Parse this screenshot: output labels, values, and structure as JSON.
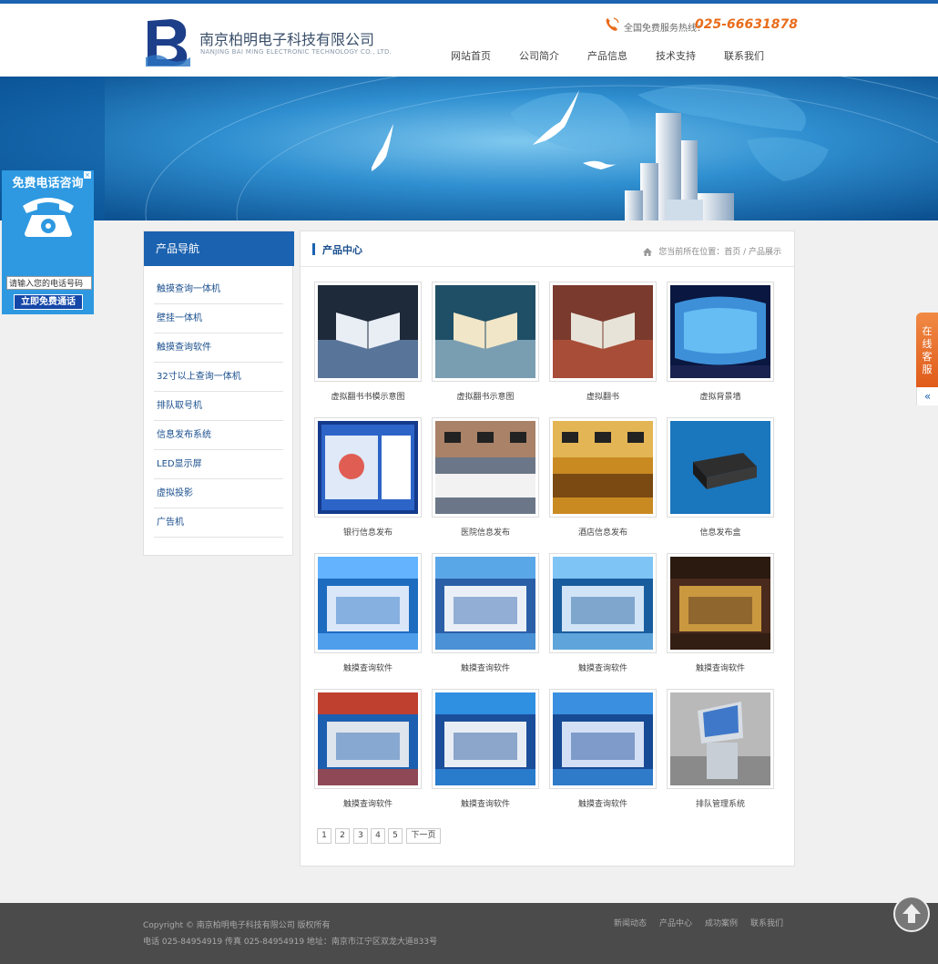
{
  "header": {
    "company_cn": "南京柏明电子科技有限公司",
    "company_en": "NANJING BAI MING ELECTRONIC TECHNOLOGY CO., LTD.",
    "hotline_label": "全国免费服务热线：",
    "hotline_number": "025-66631878",
    "nav": [
      "网站首页",
      "公司简介",
      "产品信息",
      "技术支持",
      "联系我们"
    ]
  },
  "float_call": {
    "title": "免费电话咨询",
    "close": "×",
    "input_value": "请输入您的电话号码",
    "button": "立即免费通话"
  },
  "float_kf": {
    "label": "在线客服",
    "arrow": "«"
  },
  "sidebar": {
    "title": "产品导航",
    "items": [
      "触摸查询一体机",
      "壁挂一体机",
      "触摸查询软件",
      "32寸以上查询一体机",
      "排队取号机",
      "信息发布系统",
      "LED显示屏",
      "虚拟投影",
      "广告机"
    ]
  },
  "content": {
    "title": "产品中心",
    "breadcrumb": "您当前所在位置：首页 / 产品展示",
    "products": [
      {
        "caption": "虚拟翻书书模示意图",
        "icon": "virtual-book-stand-image"
      },
      {
        "caption": "虚拟翻书示意图",
        "icon": "virtual-book-image"
      },
      {
        "caption": "虚拟翻书",
        "icon": "virtual-book-exhibit-image"
      },
      {
        "caption": "虚拟背景墙",
        "icon": "curved-screen-image"
      },
      {
        "caption": "银行信息发布",
        "icon": "bank-screen-image"
      },
      {
        "caption": "医院信息发布",
        "icon": "hospital-hall-image"
      },
      {
        "caption": "酒店信息发布",
        "icon": "hotel-counter-image"
      },
      {
        "caption": "信息发布盒",
        "icon": "media-box-image"
      },
      {
        "caption": "触摸查询软件",
        "icon": "software-screen-image"
      },
      {
        "caption": "触摸查询软件",
        "icon": "software-screen-image"
      },
      {
        "caption": "触摸查询软件",
        "icon": "software-screen-image"
      },
      {
        "caption": "触摸查询软件",
        "icon": "software-screen-image"
      },
      {
        "caption": "触摸查询软件",
        "icon": "software-screen-image"
      },
      {
        "caption": "触摸查询软件",
        "icon": "software-screen-image"
      },
      {
        "caption": "触摸查询软件",
        "icon": "software-screen-image"
      },
      {
        "caption": "排队管理系统",
        "icon": "queue-kiosk-image"
      }
    ],
    "pagination": [
      "1",
      "2",
      "3",
      "4",
      "5",
      "下一页"
    ]
  },
  "footer": {
    "copyright": "Copyright © 南京柏明电子科技有限公司 版权所有",
    "contact": "电话 025-84954919 传真 025-84954919 地址：南京市江宁区双龙大道833号",
    "links": [
      "新闻动态",
      "产品中心",
      "成功案例",
      "联系我们"
    ]
  },
  "colors": {
    "brand_blue": "#1b62b0",
    "hotline_orange": "#e86c1b",
    "call_panel_blue": "#2e99e1",
    "footer_gray": "#4b4b4b"
  }
}
